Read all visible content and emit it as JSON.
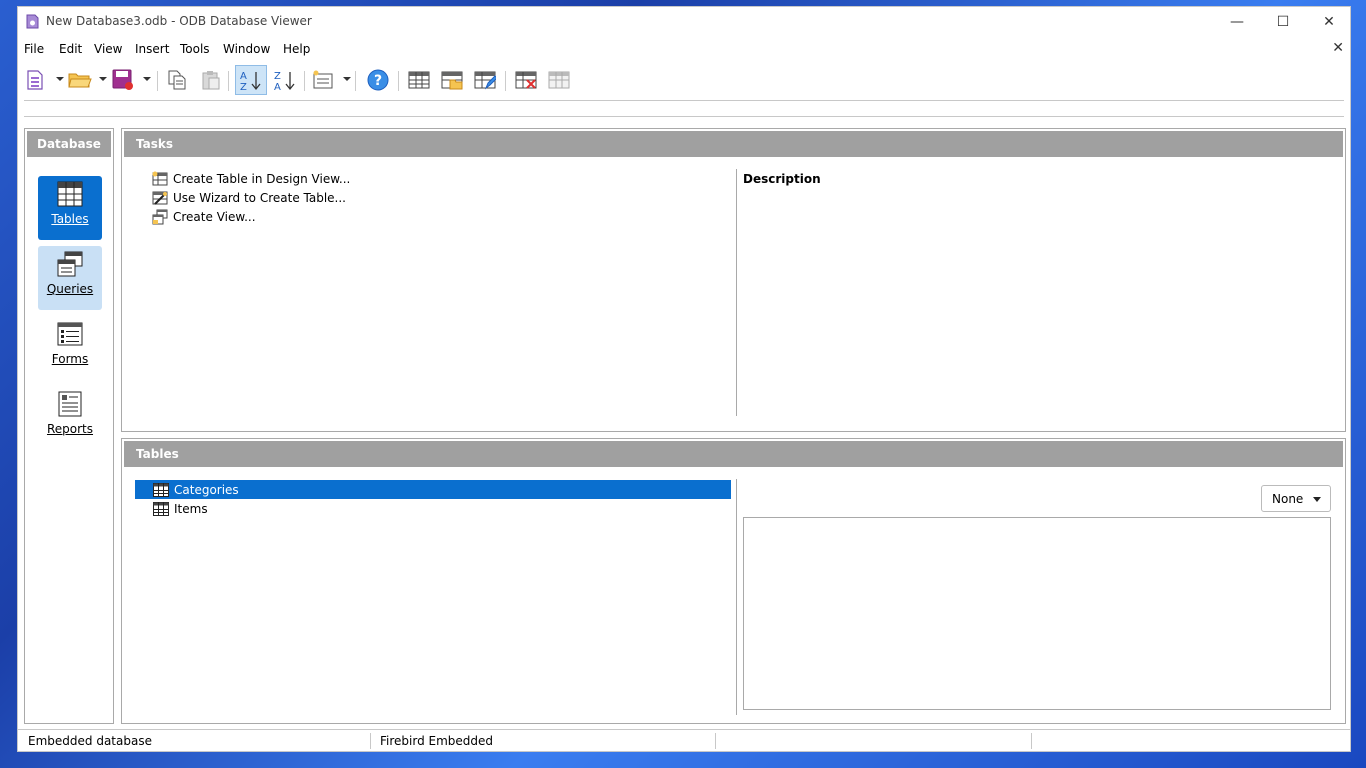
{
  "window": {
    "title": "New Database3.odb - ODB Database Viewer",
    "controls": {
      "minimize": "—",
      "maximize": "☐",
      "close": "✕"
    }
  },
  "menu": {
    "items": [
      "File",
      "Edit",
      "View",
      "Insert",
      "Tools",
      "Window",
      "Help"
    ],
    "close_doc": "✕"
  },
  "toolbar": {
    "buttons": [
      {
        "name": "new-database",
        "icon": "new-document-icon",
        "has_dropdown": true
      },
      {
        "name": "open",
        "icon": "folder-open-icon",
        "has_dropdown": true
      },
      {
        "name": "save",
        "icon": "save-icon",
        "has_dropdown": true
      },
      {
        "name": "copy",
        "icon": "copy-icon"
      },
      {
        "name": "paste",
        "icon": "paste-icon"
      },
      {
        "name": "sort-ascending",
        "icon": "sort-ascending-icon",
        "active": true
      },
      {
        "name": "sort-descending",
        "icon": "sort-descending-icon"
      },
      {
        "name": "form-new",
        "icon": "form-icon",
        "has_dropdown": true
      },
      {
        "name": "help",
        "icon": "help-icon"
      },
      {
        "name": "table",
        "icon": "table-icon"
      },
      {
        "name": "table-open",
        "icon": "table-open-icon"
      },
      {
        "name": "table-edit",
        "icon": "table-edit-icon"
      },
      {
        "name": "table-delete",
        "icon": "table-delete-icon"
      },
      {
        "name": "table-rename",
        "icon": "table-rename-icon"
      }
    ]
  },
  "sidebar": {
    "header": "Database",
    "items": [
      {
        "label": "Tables",
        "state": "selected",
        "icon": "tables-icon"
      },
      {
        "label": "Queries",
        "state": "hover",
        "icon": "queries-icon"
      },
      {
        "label": "Forms",
        "state": "normal",
        "icon": "forms-icon"
      },
      {
        "label": "Reports",
        "state": "normal",
        "icon": "reports-icon"
      }
    ]
  },
  "tasks": {
    "header": "Tasks",
    "items": [
      {
        "label": "Create Table in Design View...",
        "icon": "table-design-icon"
      },
      {
        "label": "Use Wizard to Create Table...",
        "icon": "table-wizard-icon"
      },
      {
        "label": "Create View...",
        "icon": "create-view-icon"
      }
    ],
    "description_label": "Description"
  },
  "tables": {
    "header": "Tables",
    "items": [
      {
        "label": "Categories",
        "selected": true
      },
      {
        "label": "Items",
        "selected": false
      }
    ],
    "preview_mode": "None"
  },
  "status": {
    "cells": [
      "Embedded database",
      "Firebird Embedded",
      "",
      ""
    ]
  },
  "colors": {
    "accent": "#0a6fcf",
    "hover": "#c9e0f5",
    "panel_header": "#a0a0a0"
  }
}
